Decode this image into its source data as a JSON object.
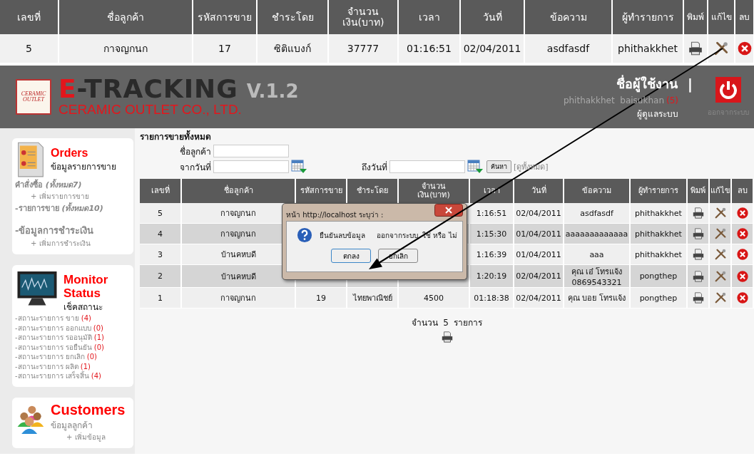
{
  "callout_table": {
    "columns": [
      "เลขที่",
      "ชื่อลูกค้า",
      "รหัสการขาย",
      "ชำระโดย",
      "จำนวน\nเงิน(บาท)",
      "เวลา",
      "วันที่",
      "ข้อความ",
      "ผู้ทำรายการ",
      "พิมพ์",
      "แก้ไข",
      "ลบ"
    ],
    "rows": [
      {
        "number": "5",
        "customer": "กาจญกนก",
        "sale_code": "17",
        "payment": "ซิติแบงก์",
        "amount": "37777",
        "time": "01:16:51",
        "date": "02/04/2011",
        "message": "asdfasdf",
        "operator": "phithakkhet"
      }
    ]
  },
  "header": {
    "logo_text": "CERAMIC OUTLET",
    "title": "E-TRACKING",
    "version": "V.1.2",
    "company": "CERAMIC OUTLET CO., LTD.",
    "user_label": "ชื่อผู้ใช้งาน",
    "separator": "|",
    "user_name": "phithakkhet  baisukhan",
    "user_count": "(5)",
    "role": "ผู้ดูแลระบบ",
    "logout_label": "ออกจากระบบ"
  },
  "sidebar": {
    "orders": {
      "title": "Orders",
      "subtitle": "ข้อมูลรายการขาย",
      "links": [
        {
          "kind": "main",
          "text": "คำสั่งซื้อ *(ทั้งหมด7)*"
        },
        {
          "kind": "add",
          "text": "+ เพิ่มรายการขาย"
        },
        {
          "kind": "main",
          "text": "-รายการขาย *(ทั้งหมด10)*"
        },
        {
          "kind": "big",
          "text": "-ข้อมูลการชำระเงิน"
        },
        {
          "kind": "add",
          "text": "+ เพิ่มการชำระเงิน"
        }
      ]
    },
    "monitor": {
      "title": "Monitor\nStatus",
      "subtitle": "เช็คสถานะ",
      "items": [
        {
          "label": "-สถานะรายการ ขาย",
          "count": "(4)"
        },
        {
          "label": "-สถานะรายการ ออกแบบ",
          "count": "(0)"
        },
        {
          "label": "-สถานะรายการ รออนุมัติ",
          "count": "(1)"
        },
        {
          "label": "-สถานะรายการ รอยืนยัน",
          "count": "(0)"
        },
        {
          "label": "-สถานะรายการ ยกเลิก",
          "count": "(0)"
        },
        {
          "label": "-สถานะรายการ ผลิต",
          "count": "(1)"
        },
        {
          "label": "-สถานะรายการ เสร็จสิ้น",
          "count": "(4)"
        }
      ]
    },
    "customers": {
      "title": "Customers",
      "subtitle": "ข้อมูลลูกค้า",
      "add": "+ เพิ่มข้อมูล"
    }
  },
  "main": {
    "section_title": "รายการขายทั้งหมด",
    "customer_label": "ชื่อลูกค้า",
    "from_label": "จากวันที่",
    "to_label": "ถึงวันที่",
    "search_button": "ค้นหา",
    "view_all": "[ดูทั้งหมด]",
    "table": {
      "columns": [
        "เลขที่",
        "ชื่อลูกค้า",
        "รหัสการขาย",
        "ชำระโดย",
        "จำนวน\nเงิน(บาท)",
        "เวลา",
        "วันที่",
        "ข้อความ",
        "ผู้ทำรายการ",
        "พิมพ์",
        "แก้ไข",
        "ลบ"
      ],
      "rows": [
        {
          "number": "5",
          "customer": "กาจญกนก",
          "time": "1:16:51",
          "date": "02/04/2011",
          "message": "asdfasdf",
          "operator": "phithakkhet"
        },
        {
          "number": "4",
          "customer": "กาจญกนก",
          "time": "1:15:30",
          "date": "01/04/2011",
          "message": "aaaaaaaaaaaaa",
          "operator": "phithakkhet"
        },
        {
          "number": "3",
          "customer": "บ้านคหบดี",
          "time": "1:16:39",
          "date": "01/04/2011",
          "message": "aaa",
          "operator": "phithakkhet"
        },
        {
          "number": "2",
          "customer": "บ้านคหบดี",
          "time": "1:20:19",
          "date": "02/04/2011",
          "message": "คุณ เอ๋ โทรแจ้ง 0869543321",
          "operator": "pongthep"
        },
        {
          "number": "1",
          "customer": "กาจญกนก",
          "sale_code": "19",
          "payment": "ไทยพาณิชย์",
          "amount": "4500",
          "time": "01:18:38",
          "date": "02/04/2011",
          "message": "คุณ บอย โทรแจ้ง",
          "operator": "pongthep"
        }
      ]
    },
    "summary": "จำนวน  5  รายการ"
  },
  "dialog": {
    "title": "หน้า http://localhost ระบุว่า :",
    "message": "ยืนยันลบข้อมูล     ออกจากระบบ  ใช่ หรือ ไม่",
    "ok": "ตกลง",
    "cancel": "ยกเลิก"
  }
}
